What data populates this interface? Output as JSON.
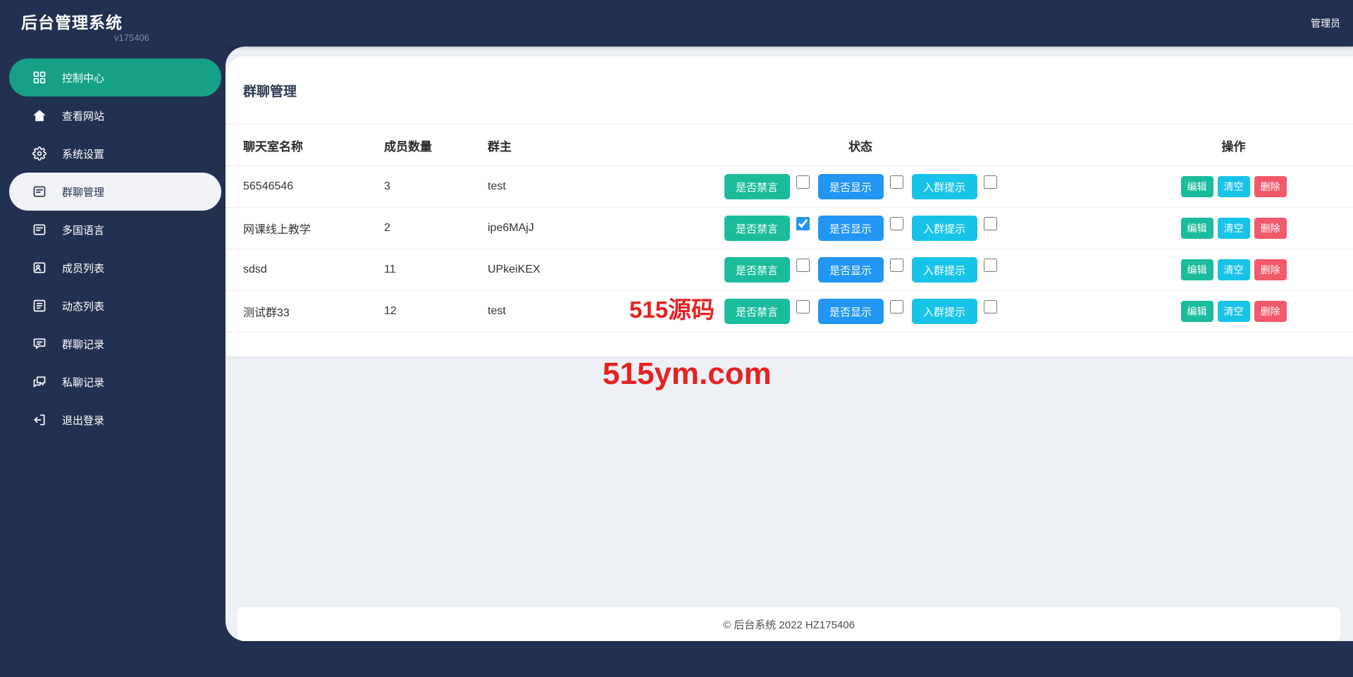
{
  "app": {
    "title": "后台管理系统",
    "version": "v175406"
  },
  "topbar": {
    "user_label": "管理员"
  },
  "sidebar": {
    "items": [
      {
        "label": "控制中心",
        "icon": "dashboard-icon",
        "state": "active-teal"
      },
      {
        "label": "查看网站",
        "icon": "home-icon",
        "state": "normal"
      },
      {
        "label": "系统设置",
        "icon": "gear-icon",
        "state": "normal"
      },
      {
        "label": "群聊管理",
        "icon": "chat-manage-icon",
        "state": "selected"
      },
      {
        "label": "多国语言",
        "icon": "language-icon",
        "state": "normal"
      },
      {
        "label": "成员列表",
        "icon": "members-icon",
        "state": "normal"
      },
      {
        "label": "动态列表",
        "icon": "feed-list-icon",
        "state": "normal"
      },
      {
        "label": "群聊记录",
        "icon": "group-history-icon",
        "state": "normal"
      },
      {
        "label": "私聊记录",
        "icon": "private-history-icon",
        "state": "normal"
      },
      {
        "label": "退出登录",
        "icon": "logout-icon",
        "state": "normal"
      }
    ]
  },
  "page": {
    "title": "群聊管理"
  },
  "table": {
    "headers": {
      "name": "聊天室名称",
      "members": "成员数量",
      "owner": "群主",
      "status": "状态",
      "actions": "操作"
    },
    "status_buttons": {
      "mute": "是否禁言",
      "show": "是否显示",
      "join_tip": "入群提示"
    },
    "action_buttons": {
      "edit": "编辑",
      "clear": "清空",
      "delete": "删除"
    },
    "rows": [
      {
        "name": "56546546",
        "members": "3",
        "owner": "test",
        "checks": [
          false,
          false,
          false
        ]
      },
      {
        "name": "网课线上教学",
        "members": "2",
        "owner": "ipe6MAjJ",
        "checks": [
          true,
          false,
          false
        ]
      },
      {
        "name": "sdsd",
        "members": "11",
        "owner": "UPkeiKEX",
        "checks": [
          false,
          false,
          false
        ]
      },
      {
        "name": "测试群33",
        "members": "12",
        "owner": "test",
        "checks": [
          false,
          false,
          false
        ]
      }
    ]
  },
  "watermarks": {
    "line1": "515源码",
    "line2": "515ym.com"
  },
  "footer": {
    "text": "© 后台系统 2022 HZ175406"
  },
  "colors": {
    "navy": "#233150",
    "sidebar_active": "#16a085",
    "button_teal": "#1abc9c",
    "button_blue": "#2196f3",
    "button_cyan": "#18c3e8",
    "button_red": "#f2596b",
    "watermark_red": "#e62222",
    "main_bg": "#edf0f5"
  }
}
